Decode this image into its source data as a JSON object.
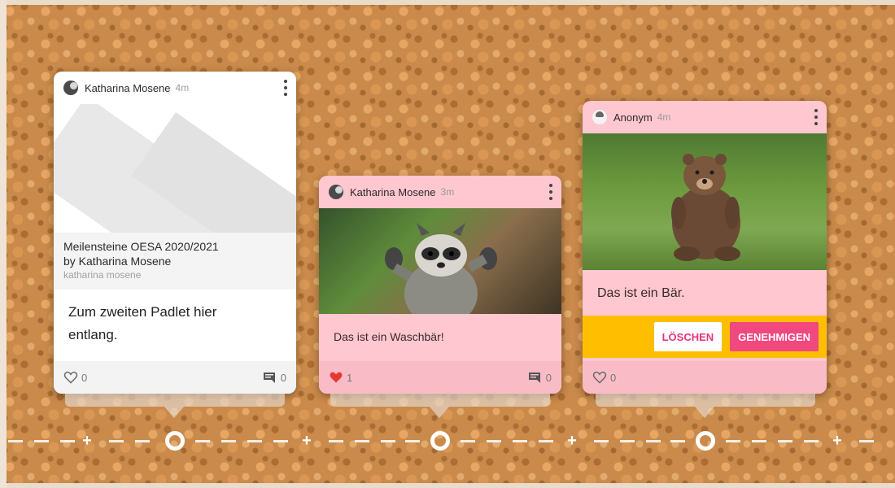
{
  "cards": [
    {
      "author": "Katharina Mosene",
      "time": "4m",
      "attachment_title": "Meilensteine OESA 2020/2021",
      "attachment_by": "by Katharina Mosene",
      "attachment_source": "katharina mosene",
      "body": "Zum zweiten Padlet hier entlang.",
      "likes": "0",
      "comments": "0"
    },
    {
      "author": "Katharina Mosene",
      "time": "3m",
      "body": "Das ist ein Waschbär!",
      "likes": "1",
      "comments": "0"
    },
    {
      "author": "Anonym",
      "time": "4m",
      "body": "Das ist ein Bär.",
      "likes": "0",
      "delete_label": "LÖSCHEN",
      "approve_label": "GENEHMIGEN"
    }
  ],
  "colors": {
    "pink_card": "#ffc7d0",
    "moderation_bar": "#ffbf00",
    "approve": "#f0487f",
    "liked_heart": "#e53935"
  }
}
